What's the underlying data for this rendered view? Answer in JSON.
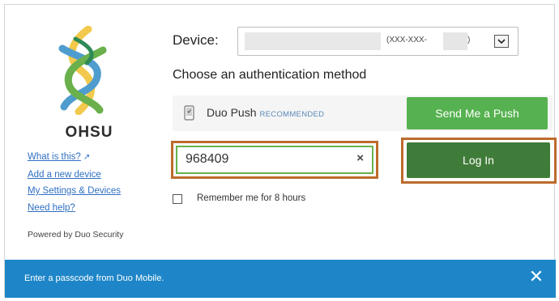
{
  "brand": {
    "name": "OHSU"
  },
  "sidebar": {
    "links": [
      "What is this?",
      "Add a new device",
      "My Settings & Devices",
      "Need help?"
    ],
    "powered_by": "Powered by Duo Security"
  },
  "device": {
    "label": "Device:",
    "masked_number": "(XXX-XXX-",
    "masked_close": ")"
  },
  "auth": {
    "heading": "Choose an authentication method",
    "push_method": "Duo Push",
    "recommended": "RECOMMENDED",
    "push_button": "Send Me a Push",
    "passcode_value": "968409",
    "clear_glyph": "×",
    "login_button": "Log In",
    "remember_label": "Remember me for 8 hours",
    "remember_checked": false
  },
  "status": {
    "message": "Enter a passcode from Duo Mobile.",
    "close_glyph": "✕"
  },
  "colors": {
    "push_green": "#56b250",
    "login_green": "#407c39",
    "highlight_orange": "#bd6b2c",
    "status_blue": "#1e86c8",
    "link_blue": "#2f6fc2"
  }
}
